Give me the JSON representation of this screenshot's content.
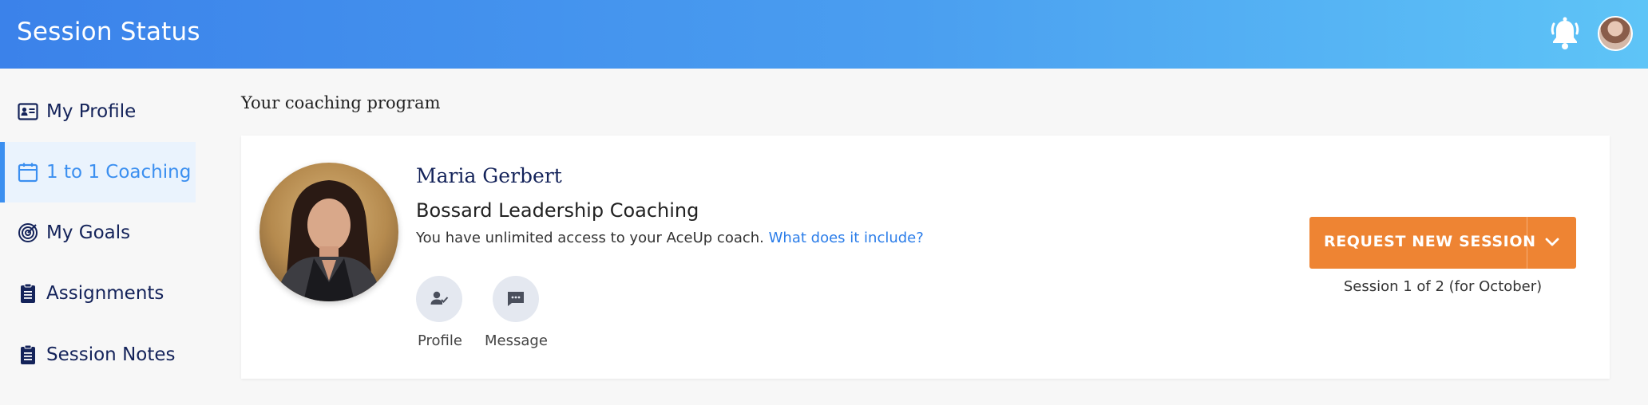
{
  "header": {
    "title": "Session Status",
    "bell_icon": "bell-icon",
    "avatar": "user-avatar"
  },
  "sidebar": {
    "items": [
      {
        "label": "My Profile",
        "icon": "id-card-icon",
        "active": false
      },
      {
        "label": "1 to 1 Coaching",
        "icon": "calendar-icon",
        "active": true
      },
      {
        "label": "My Goals",
        "icon": "target-icon",
        "active": false
      },
      {
        "label": "Assignments",
        "icon": "clipboard-icon",
        "active": false
      },
      {
        "label": "Session Notes",
        "icon": "clipboard-icon",
        "active": false
      }
    ]
  },
  "main": {
    "section_title": "Your coaching program",
    "coach": {
      "name": "Maria Gerbert",
      "program": "Bossard Leadership Coaching",
      "access_text": "You have unlimited access to your AceUp coach.",
      "access_link": "What does it include?"
    },
    "actions": [
      {
        "label": "Profile",
        "icon": "person-check-icon"
      },
      {
        "label": "Message",
        "icon": "chat-icon"
      }
    ],
    "request_button": {
      "label": "REQUEST NEW SESSION",
      "chevron_icon": "chevron-down-icon"
    },
    "session_status": "Session 1 of 2 (for October)"
  },
  "colors": {
    "header_gradient_start": "#3b82ea",
    "header_gradient_end": "#5ec4f7",
    "nav_text": "#14235a",
    "active_accent": "#3b8ff0",
    "active_bg": "#eaf3fd",
    "primary_button": "#ee8433",
    "link": "#2b7de9"
  }
}
